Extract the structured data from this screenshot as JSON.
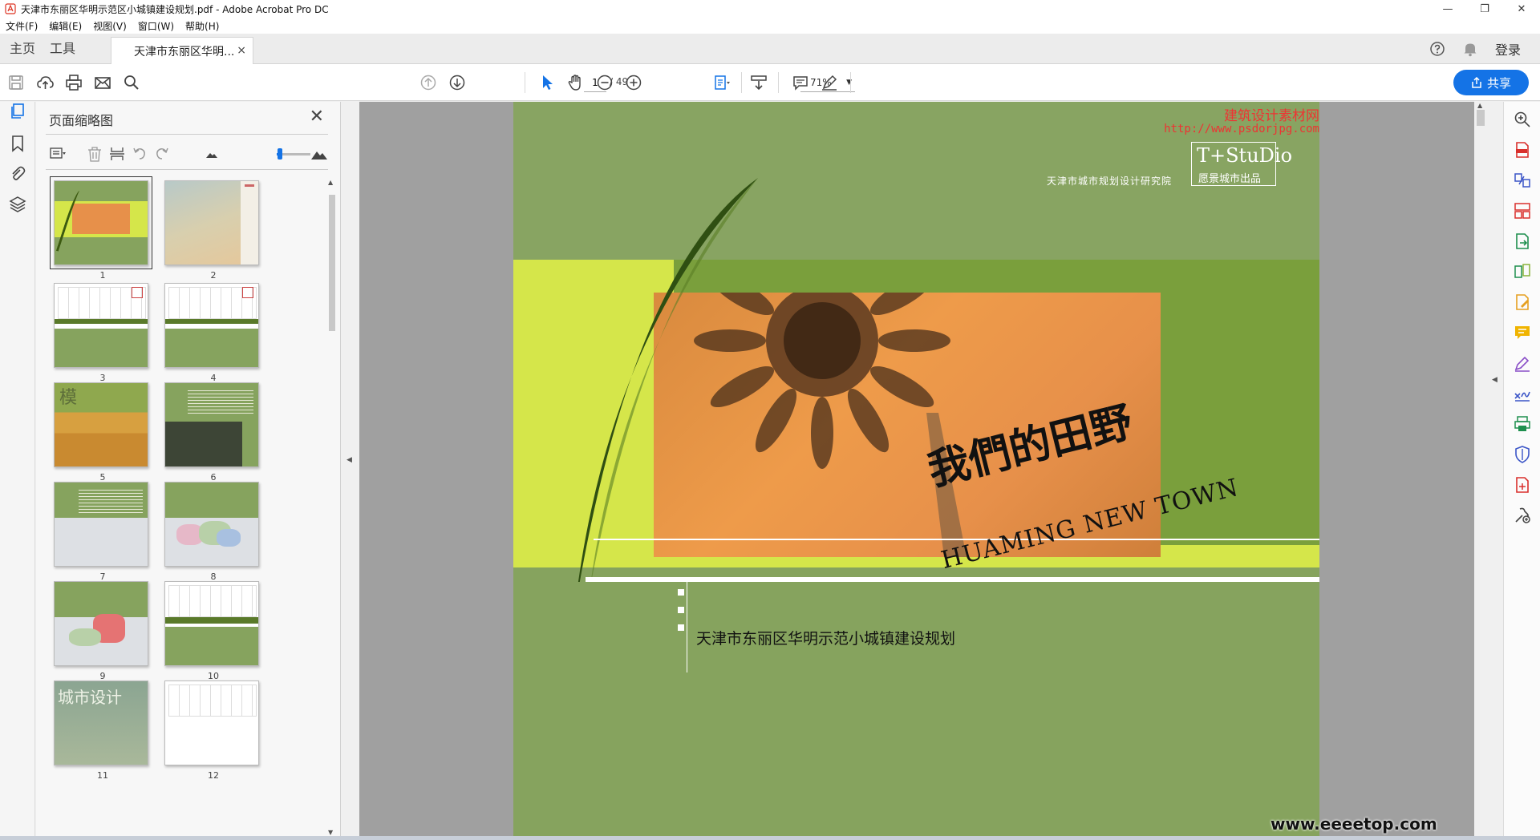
{
  "window": {
    "title": "天津市东丽区华明示范区小城镇建设规划.pdf - Adobe Acrobat Pro DC",
    "controls": [
      "—",
      "❐",
      "✕"
    ]
  },
  "menu": [
    "文件(F)",
    "编辑(E)",
    "视图(V)",
    "窗口(W)",
    "帮助(H)"
  ],
  "tabs": {
    "home": "主页",
    "tools": "工具",
    "document": "天津市东丽区华明...",
    "close": "×",
    "login": "登录"
  },
  "toolbar": {
    "page_current": "1",
    "page_total": "/ 49",
    "zoom": "71%",
    "share": "共享"
  },
  "thumbnails": {
    "title": "页面缩略图",
    "close": "✕",
    "slider_value": 0.1,
    "pages": [
      "1",
      "2",
      "3",
      "4",
      "5",
      "6",
      "7",
      "8",
      "9",
      "10",
      "11",
      "12"
    ]
  },
  "page": {
    "watermark_cn": "建筑设计素材网",
    "watermark_url": "http://www.psdorjpg.com",
    "studio_name": "T+StuDio",
    "studio_sub": "愿景城市出品",
    "institute": "天津市城市规划设计研究院",
    "cn_title": "我們的田野",
    "en_title": "HUAMING NEW TOWN",
    "doc_title": "天津市东丽区华明示范小城镇建设规划"
  },
  "thumb_texts": {
    "t5": "模",
    "t11": "城市设计"
  },
  "footer_watermark": "www.eeeetop.com",
  "colors": {
    "accent": "#1473e6",
    "page_green": "#86a35e",
    "band_yellow": "#d5e64a",
    "photo_orange": "#e7904a",
    "watermark_red": "#ee3333"
  }
}
